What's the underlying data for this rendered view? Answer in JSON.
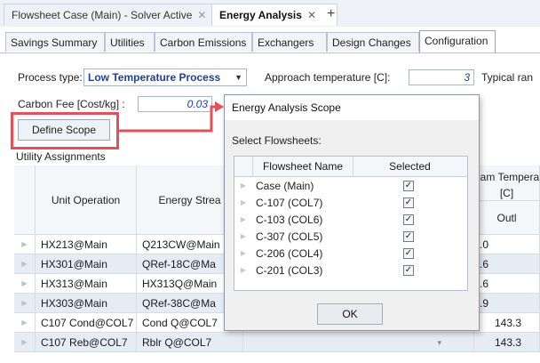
{
  "doc_tabs": [
    {
      "label": "Flowsheet Case (Main) - Solver Active",
      "close": "✕"
    },
    {
      "label": "Energy Analysis",
      "close": "✕"
    }
  ],
  "add_tab": "+",
  "sub_tabs": [
    "Savings Summary",
    "Utilities",
    "Carbon Emissions",
    "Exchangers",
    "Design Changes",
    "Configuration"
  ],
  "form": {
    "process_type_label": "Process type:",
    "process_type_value": "Low Temperature Process",
    "approach_temp_label": "Approach temperature [C]:",
    "approach_temp_value": "3",
    "typical_label": "Typical ran",
    "carbon_fee_label": "Carbon Fee [Cost/kg] :",
    "carbon_fee_value": "0.03",
    "define_scope": "Define Scope",
    "utility_assignments": "Utility Assignments"
  },
  "highlight_color": "#e0525a",
  "grid": {
    "headers": {
      "unit_operation": "Unit Operation",
      "energy_stream": "Energy Strea",
      "steam_temp": "eam Tempera",
      "steam_temp_unit": "[C]",
      "outlet": "Outl"
    },
    "rows": [
      {
        "unit": "HX213@Main",
        "stream": "Q213CW@Main",
        "temp": ".0"
      },
      {
        "unit": "HX301@Main",
        "stream": "QRef-18C@Ma",
        "temp": ".6"
      },
      {
        "unit": "HX313@Main",
        "stream": "HX313Q@Main",
        "temp": ".6"
      },
      {
        "unit": "HX303@Main",
        "stream": "QRef-38C@Ma",
        "temp": ".9"
      },
      {
        "unit": "C107 Cond@COL7",
        "stream": "Cond Q@COL7",
        "temp": "143.3"
      },
      {
        "unit": "C107 Reb@COL7",
        "stream": "Rblr Q@COL7",
        "temp": "143.3"
      }
    ]
  },
  "dialog": {
    "title": "Energy Analysis Scope",
    "subtitle": "Select Flowsheets:",
    "col_name": "Flowsheet Name",
    "col_selected": "Selected",
    "rows": [
      {
        "name": "Case (Main)",
        "check": "✓"
      },
      {
        "name": "C-107 (COL7)",
        "check": "✓"
      },
      {
        "name": "C-103 (COL6)",
        "check": "✓"
      },
      {
        "name": "C-307 (COL5)",
        "check": "✓"
      },
      {
        "name": "C-206 (COL4)",
        "check": "✓"
      },
      {
        "name": "C-201 (COL3)",
        "check": "✓"
      }
    ],
    "ok": "OK"
  }
}
